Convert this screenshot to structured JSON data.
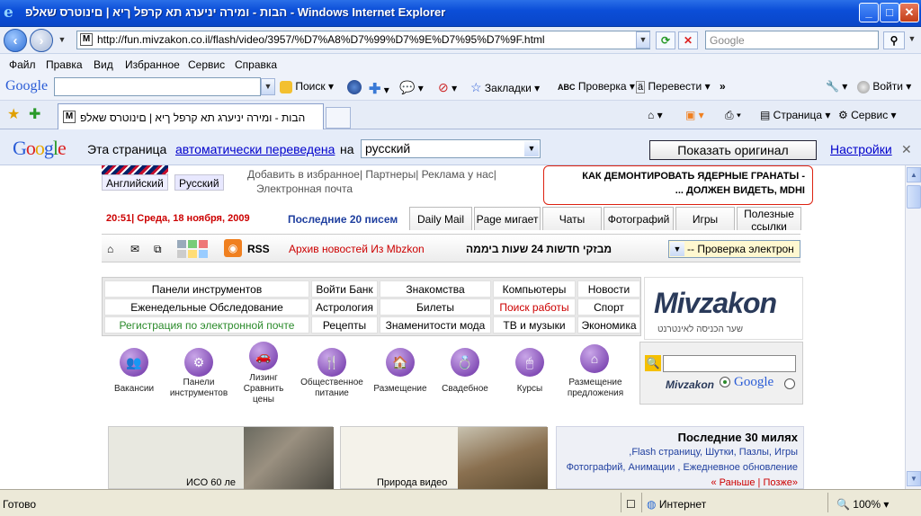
{
  "window": {
    "title": "הבות - ומירה יניערג תא קרפל ךיא | םינוטרס שאלפ - Windows Internet Explorer",
    "minimize": "_",
    "maximize": "□",
    "close": "✕"
  },
  "address": {
    "url": "http://fun.mivzakon.co.il/flash/video/3957/%D7%A8%D7%99%D7%9E%D7%95%D7%9F.html",
    "search_placeholder": "Google",
    "favicon": "M"
  },
  "menu": [
    "Файл",
    "Правка",
    "Вид",
    "Избранное",
    "Сервис",
    "Справка"
  ],
  "google_toolbar": {
    "logo": "Google",
    "search": "Поиск",
    "bookmarks": "Закладки",
    "check": "Проверка",
    "translate": "Перевести",
    "more": "»",
    "signin": "Войти"
  },
  "tabs": {
    "active_label": "הבות - ומירה יניערג תא קרפל ךיא | םינוטרס שאלפ",
    "page": "Страница",
    "service": "Сервис"
  },
  "translate_bar": {
    "logo": "Google",
    "prefix": "Эта страница",
    "link": "автоматически переведена",
    "on": "на",
    "language": "русский",
    "show_original": "Показать оригинал",
    "settings": "Настройки",
    "close": "✕"
  },
  "site": {
    "lang_en": "Английский",
    "lang_ru": "Русский",
    "top_links_line1": "Добавить в избранное| Партнеры| Реклама у нас|",
    "top_links_line2": "Электронная почта",
    "headline_line1": "КАК ДЕМОНТИРОВАТЬ ЯДЕРНЫЕ ГРАНАТЫ -",
    "headline_line2": "... ДОЛЖЕН ВИДЕТЬ, MDHI",
    "datetime": "20:51| Среда, 18 ноября, 2009",
    "last20": "Последние 20 писем",
    "page_tabs": [
      "Daily Mail",
      "Page мигает",
      "Чаты",
      "Фотографий",
      "Игры"
    ],
    "useful_links": "Полезные ссылки",
    "rss": "RSS",
    "archive": "Архив новостей Из Mbzkon",
    "ticker": "מבזקי חדשות 24 שעות ביממה",
    "email_check": "-- Проверка электрон",
    "nav": [
      [
        "Панели инструментов",
        "Войти Банк",
        "Знакомства",
        "Компьютеры",
        "Новости"
      ],
      [
        "Еженедельные Обследование",
        "Астрология",
        "Билеты",
        "Поиск работы",
        "Спорт"
      ],
      [
        "Регистрация по электронной почте",
        "Рецепты",
        "Знаменитости мода",
        "ТВ и музыки",
        "Экономика"
      ]
    ],
    "logo": "Mivzakon",
    "logo_sub": "שער הכניסה לאינטרנט",
    "categories": [
      {
        "label": "Вакансии",
        "glyph": "👥"
      },
      {
        "label": "Панели инструментов",
        "glyph": "⚙"
      },
      {
        "label": "Лизинг Сравнить цены",
        "glyph": "🚗"
      },
      {
        "label": "Общественное питание",
        "glyph": "🍴"
      },
      {
        "label": "Размещение",
        "glyph": "🏠"
      },
      {
        "label": "Свадебное",
        "glyph": "💍"
      },
      {
        "label": "Курсы",
        "glyph": "🖱"
      },
      {
        "label": "Размещение предложения",
        "glyph": "⌂"
      }
    ],
    "search_logo_m": "Mivzakon",
    "search_logo_g": "Google",
    "last30_title": "Последние 30 милях",
    "last30_line1": ",Flash страницу, Шутки, Пазлы, Игры",
    "last30_line2": "Фотографий, Анимации , Ежедневное обновление",
    "prev": "« Раньше",
    "next": "Позже»",
    "story1": "ИСО 60 ле",
    "story2": "Природа видео"
  },
  "status": {
    "ready": "Готово",
    "zone": "Интернет",
    "zoom": "100%"
  },
  "colors": {
    "title_blue": "#0b4ed8",
    "link_blue": "#1f3f9f",
    "headline_border": "#dd2211",
    "registration_green": "#2a8a2a",
    "job_search_red": "#cc0000",
    "category_purple": "#6a2ea4"
  }
}
